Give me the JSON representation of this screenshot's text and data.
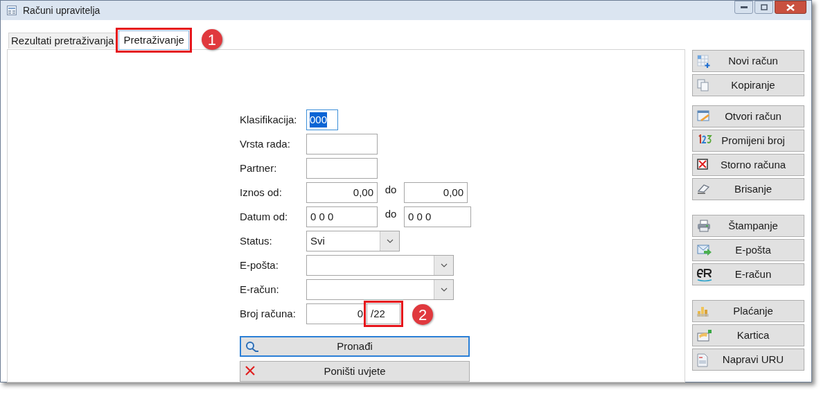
{
  "window": {
    "title": "Računi upravitelja"
  },
  "tabs": [
    {
      "label": "Rezultati pretraživanja",
      "selected": false
    },
    {
      "label": "Pretraživanje",
      "selected": true,
      "callout": "1"
    }
  ],
  "form": [
    {
      "kind": "code",
      "label": "Klasifikacija:",
      "value": "000",
      "focused": true
    },
    {
      "kind": "text",
      "label": "Vrsta rada:"
    },
    {
      "kind": "text",
      "label": "Partner:"
    },
    {
      "kind": "amount-range",
      "label": "Iznos od:",
      "from": "0,00",
      "to_label": "do",
      "to": "0,00"
    },
    {
      "kind": "date-range",
      "label": "Datum od:",
      "from": "0 0  0",
      "to_label": "do",
      "to": "0 0  0"
    },
    {
      "kind": "short-select",
      "label": "Status:",
      "value": "Svi"
    },
    {
      "kind": "select",
      "label": "E-pošta:"
    },
    {
      "kind": "select",
      "label": "E-račun:"
    },
    {
      "kind": "invoice-number",
      "label": "Broj računa:",
      "number": "0",
      "suffix": "/22",
      "callout": "2"
    }
  ],
  "form_buttons": [
    {
      "label": "Pronađi",
      "focused": true
    },
    {
      "label": "Poništi uvjete",
      "focused": false
    }
  ],
  "side_groups": [
    [
      "Novi račun",
      "Kopiranje"
    ],
    [
      "Otvori račun",
      "Promijeni broj",
      "Storno računa",
      "Brisanje"
    ],
    [
      "Štampanje",
      "E-pošta",
      "E-račun"
    ],
    [
      "Plaćanje",
      "Kartica",
      "Napravi URU"
    ]
  ]
}
